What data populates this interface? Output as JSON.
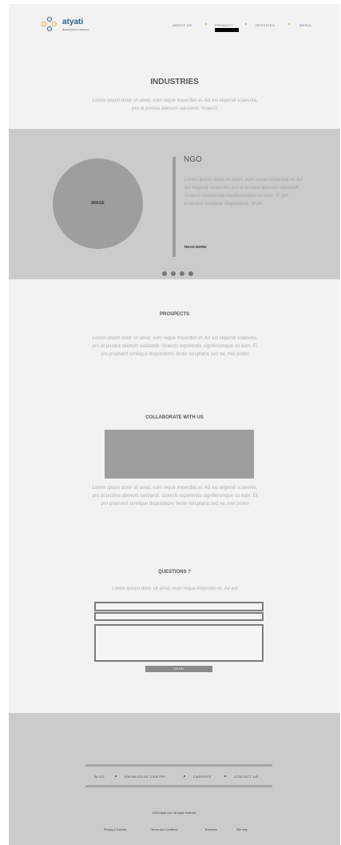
{
  "header": {
    "brand": "atyati",
    "tagline": "Reaching the unreached",
    "nav": [
      "ABOUT US",
      "PRODUCT",
      "SERVICES",
      "MEDIA"
    ]
  },
  "industries": {
    "title": "INDUSTRIES",
    "text": "Lorem ipsum dolor sit amet, eum reque imperdiet et. Ad est eligendi scaevola, pro at postea alienum salutandi. Graecis"
  },
  "slider": {
    "image_label": "IMAGE",
    "heading": "NGO",
    "text": "Lorem ipsum dolor sit amet, eum reque imperdiet et. Ad est eligendi scaevola, pro at postea alienum salutandi. Graecis expetenda signiferumque cu eam. Ei pro praesent similique disputationi, brute",
    "read_more": "READ MORE"
  },
  "prospects": {
    "title": "PROSPECTS",
    "text": "Lorem ipsum dolor sit amet, eum reque imperdiet et. Ad est eligendi scaevola, pro at postea alienum salutandi. Graecis expetenda signiferumque cu eam. Ei pro praesent similique disputationi, brute voluptaria sed ne, mei probo"
  },
  "collaborate": {
    "title": "COLLABORATE WITH US",
    "text": "Lorem ipsum dolor sit amet, eum reque imperdiet et. Ad est eligendi scaevola, pro at postea alienum salutandi. Graecis expetenda signiferumque cu eam. Ei pro praesent similique disputationi, brute voluptaria sed ne, mei probo"
  },
  "questions": {
    "title": "QUESTIONS ?",
    "text": "Lorem ipsum dolor sit amet, eum reque imperdiet et. Ad est",
    "send_label": "SEND"
  },
  "footer": {
    "links": [
      "BLOG",
      "KNOWLEDGE CENTRE",
      "CAREERS",
      "CONTACT US"
    ],
    "copyright": "2016 Atyati.com.  All rights reserved.",
    "bottom_links": [
      "Privacy & Cookies",
      "Terms and Conditions",
      "Branches",
      "Site map"
    ]
  },
  "colors": {
    "page_bg": "#f2f2f2",
    "band_bg": "#cbcbcb",
    "brand": "#2d5f86",
    "nav_dot": "#e3a02c"
  }
}
